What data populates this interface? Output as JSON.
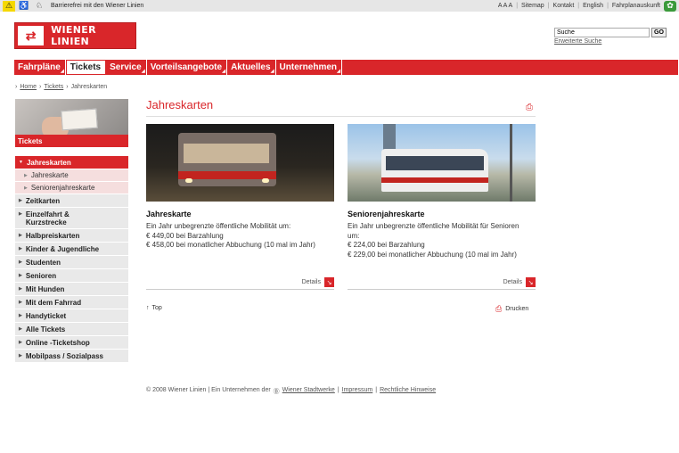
{
  "topbar": {
    "accessibility_text": "Barrierefrei mit den Wiener Linien",
    "font_size": "A A A",
    "links": [
      "Sitemap",
      "Kontakt",
      "English",
      "Fahrplanauskunft"
    ]
  },
  "header": {
    "logo_text": "WIENER LINIEN",
    "search_value": "Suche",
    "search_button": "GO",
    "advanced_search": "Erweiterte Suche"
  },
  "nav": {
    "items": [
      "Fahrpläne",
      "Tickets",
      "Service",
      "Vorteilsangebote",
      "Aktuelles",
      "Unternehmen"
    ]
  },
  "breadcrumb": {
    "home": "Home",
    "tickets": "Tickets",
    "current": "Jahreskarten"
  },
  "sidebar": {
    "heading": "Tickets",
    "current": "Jahreskarten",
    "subitems": [
      "Jahreskarte",
      "Seniorenjahreskarte"
    ],
    "items": [
      "Zeitkarten",
      "Einzelfahrt & Kurzstrecke",
      "Halbpreiskarten",
      "Kinder & Jugendliche",
      "Studenten",
      "Senioren",
      "Mit Hunden",
      "Mit dem Fahrrad",
      "Handyticket",
      "Alle Tickets",
      "Online -Ticketshop",
      "Mobilpass / Sozialpass"
    ]
  },
  "content": {
    "title": "Jahreskarten",
    "cards": [
      {
        "title": "Jahreskarte",
        "text": "Ein Jahr unbegrenzte öffentliche Mobilität um:",
        "price1": "€ 449,00 bei Barzahlung",
        "price2": "€ 458,00 bei monatlicher Abbuchung (10 mal im Jahr)",
        "details": "Details"
      },
      {
        "title": "Seniorenjahreskarte",
        "text": "Ein Jahr unbegrenzte öffentliche Mobilität für Senioren um:",
        "price1": "€ 224,00 bei Barzahlung",
        "price2": "€ 229,00 bei monatlicher Abbuchung (10 mal im Jahr)",
        "details": "Details"
      }
    ],
    "top_link": "Top",
    "print_link": "Drucken"
  },
  "footer": {
    "copyright": "© 2008 Wiener Linien | Ein Unternehmen der",
    "stadtwerke": "Wiener Stadtwerke",
    "impressum": "Impressum",
    "hinweise": "Rechtliche Hinweise"
  },
  "colors": {
    "brand_red": "#d9262a"
  }
}
